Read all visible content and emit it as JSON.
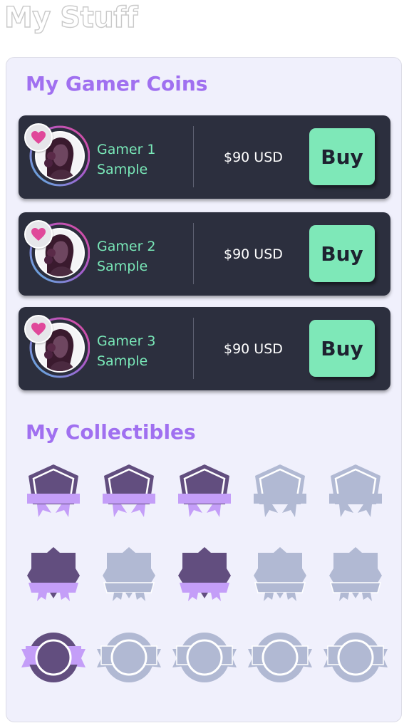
{
  "page": {
    "title": "My Stuff"
  },
  "coins_section": {
    "title": "My Gamer Coins",
    "cards": [
      {
        "name_line1": "Gamer 1",
        "name_line2": "Sample",
        "price": "$90 USD",
        "buy_label": "Buy"
      },
      {
        "name_line1": "Gamer 2",
        "name_line2": "Sample",
        "price": "$90 USD",
        "buy_label": "Buy"
      },
      {
        "name_line1": "Gamer 3",
        "name_line2": "Sample",
        "price": "$90 USD",
        "buy_label": "Buy"
      }
    ]
  },
  "collectibles_section": {
    "title": "My Collectibles",
    "rows": [
      {
        "shape": "pentagon-badge",
        "unlocked": [
          true,
          true,
          true,
          false,
          false
        ]
      },
      {
        "shape": "square-badge",
        "unlocked": [
          true,
          false,
          true,
          false,
          false
        ]
      },
      {
        "shape": "round-badge",
        "unlocked": [
          true,
          false,
          false,
          false,
          false
        ]
      }
    ]
  },
  "colors": {
    "accent": "#a070f0",
    "card_bg": "#2c2f3e",
    "mint": "#7ee8b8",
    "badge_unlocked": "#624e7f",
    "ribbon_unlocked": "#c49ef8",
    "badge_locked": "#b1b9d3",
    "heart": "#e0489a"
  },
  "icons": {
    "favorite": "heart-icon",
    "avatar": "gamer-avatar"
  }
}
